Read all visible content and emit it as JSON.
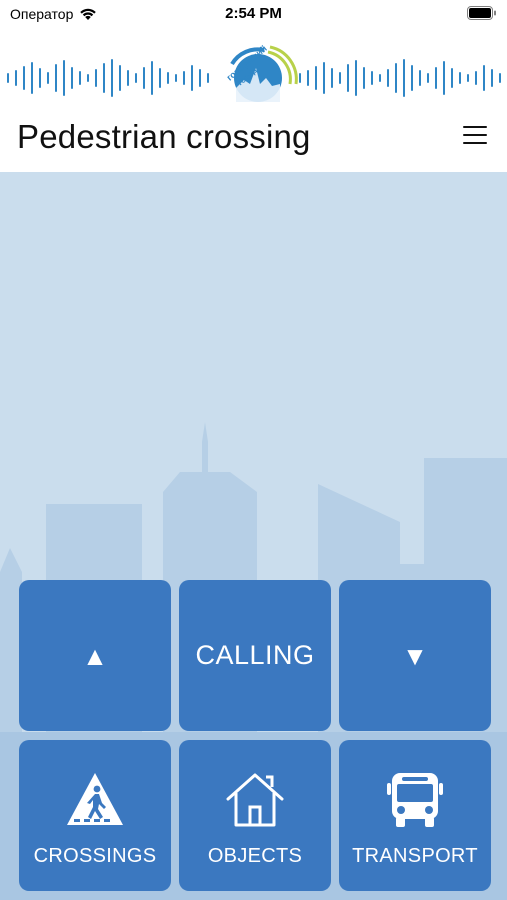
{
  "status_bar": {
    "carrier": "Оператор",
    "time": "2:54 PM"
  },
  "logo": {
    "text_top": "говорящий",
    "text_bottom": "город"
  },
  "header": {
    "title": "Pedestrian crossing"
  },
  "controls": {
    "up_symbol": "▲",
    "calling_label": "CALLING",
    "down_symbol": "▼"
  },
  "nav": {
    "crossings_label": "CROSSINGS",
    "objects_label": "OBJECTS",
    "transport_label": "TRANSPORT"
  },
  "colors": {
    "tile": "#3b78c0",
    "background": "#c9dcec",
    "logo_wave": "#2f86c6",
    "logo_arc": "#b8d14a"
  },
  "icons": [
    "wifi-icon",
    "battery-icon",
    "menu-icon",
    "pedestrian-crossing-icon",
    "house-icon",
    "bus-icon"
  ]
}
